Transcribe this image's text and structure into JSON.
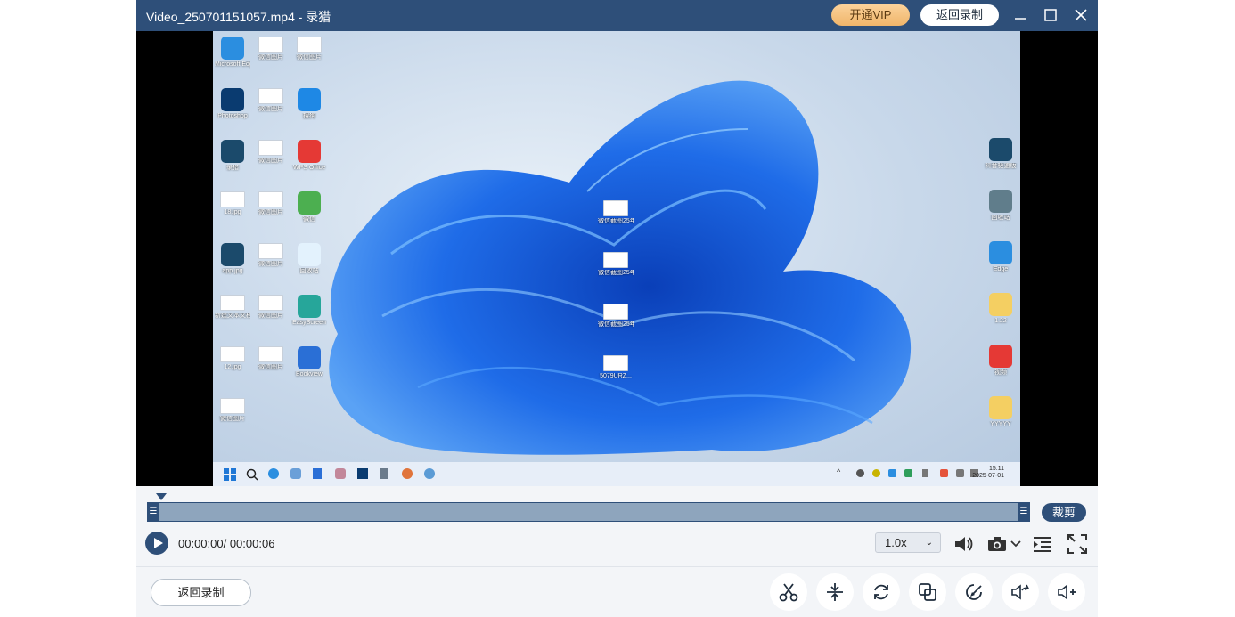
{
  "window": {
    "title": "Video_250701151057.mp4  -  录猎",
    "vip_label": "开通VIP",
    "back_label": "返回录制"
  },
  "colors": {
    "brand": "#2e4f79",
    "vip": "#f4bd76",
    "track": "#8ea5bd"
  },
  "desktop": {
    "left_icons": [
      {
        "label": "Microsoft Edge",
        "color": "#2b8ee0"
      },
      {
        "label": "微信图片",
        "color": "#ffffff"
      },
      {
        "label": "微信图片",
        "color": "#ffffff"
      },
      {
        "label": "Photoshop",
        "color": "#0a3b70"
      },
      {
        "label": "微信图片",
        "color": "#ffffff"
      },
      {
        "label": "搜狗",
        "color": "#1e88e5"
      },
      {
        "label": "录猎",
        "color": "#1b4a6b"
      },
      {
        "label": "微信图片",
        "color": "#ffffff"
      },
      {
        "label": "WPS Office",
        "color": "#e53935"
      },
      {
        "label": "18.jpg",
        "color": "#ffffff"
      },
      {
        "label": "微信图片",
        "color": "#ffffff"
      },
      {
        "label": "微信",
        "color": "#4caf50"
      },
      {
        "label": "app.jpg",
        "color": "#1b4a6b"
      },
      {
        "label": "微信图片",
        "color": "#ffffff"
      },
      {
        "label": "回收站",
        "color": "#e3f2fd"
      },
      {
        "label": "新建文本文档",
        "color": "#ffffff"
      },
      {
        "label": "微信图片",
        "color": "#ffffff"
      },
      {
        "label": "EasyScreen",
        "color": "#26a69a"
      },
      {
        "label": "12.jpg",
        "color": "#ffffff"
      },
      {
        "label": "微信图片",
        "color": "#ffffff"
      },
      {
        "label": "Bookview",
        "color": "#2a6fd6"
      },
      {
        "label": "微信图片",
        "color": "#ffffff"
      }
    ],
    "center_icons": [
      {
        "label": "微信截图25年06月26..."
      },
      {
        "label": "微信截图25年06月26..."
      },
      {
        "label": "微信截图25年06月26..."
      },
      {
        "label": "5079URZ..."
      }
    ],
    "right_icons": [
      {
        "label": "抖音极速版",
        "color": "#1b4a6b"
      },
      {
        "label": "回收站",
        "color": "#607d8b"
      },
      {
        "label": "Edge",
        "color": "#2b8ee0"
      },
      {
        "label": "1.22",
        "color": "#f4cf62"
      },
      {
        "label": "视频",
        "color": "#e53935"
      },
      {
        "label": "YYYYY",
        "color": "#f4cf62"
      }
    ],
    "clock_time": "15:11",
    "clock_date": "2025-07-01"
  },
  "timeline": {
    "crop_label": "裁剪",
    "progress": 0.0
  },
  "controls": {
    "time_text": "00:00:00/ 00:00:06",
    "speed": "1.0x",
    "icons": [
      "volume-icon",
      "camera-icon",
      "playlist-icon",
      "fullscreen-icon"
    ]
  },
  "bottom": {
    "back_label": "返回录制",
    "tools": [
      "cut-tool",
      "compress-tool",
      "rotate-tool",
      "merge-tool",
      "edit-tool",
      "audio-extract-tool",
      "add-audio-tool"
    ]
  }
}
